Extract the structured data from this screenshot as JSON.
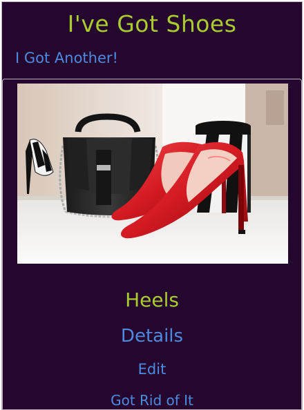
{
  "header": {
    "title": "I've Got Shoes",
    "add_link_label": "I Got Another!"
  },
  "shoe_card": {
    "image": {
      "subject": "red-high-heels-and-black-handbag-photo"
    },
    "name": "Heels",
    "details_label": "Details",
    "edit_label": "Edit",
    "remove_label": "Got Rid of It"
  },
  "colors": {
    "background": "#24062f",
    "title_green": "#a9cc2f",
    "link_blue": "#4d8be0",
    "border": "#b9b2bd"
  }
}
